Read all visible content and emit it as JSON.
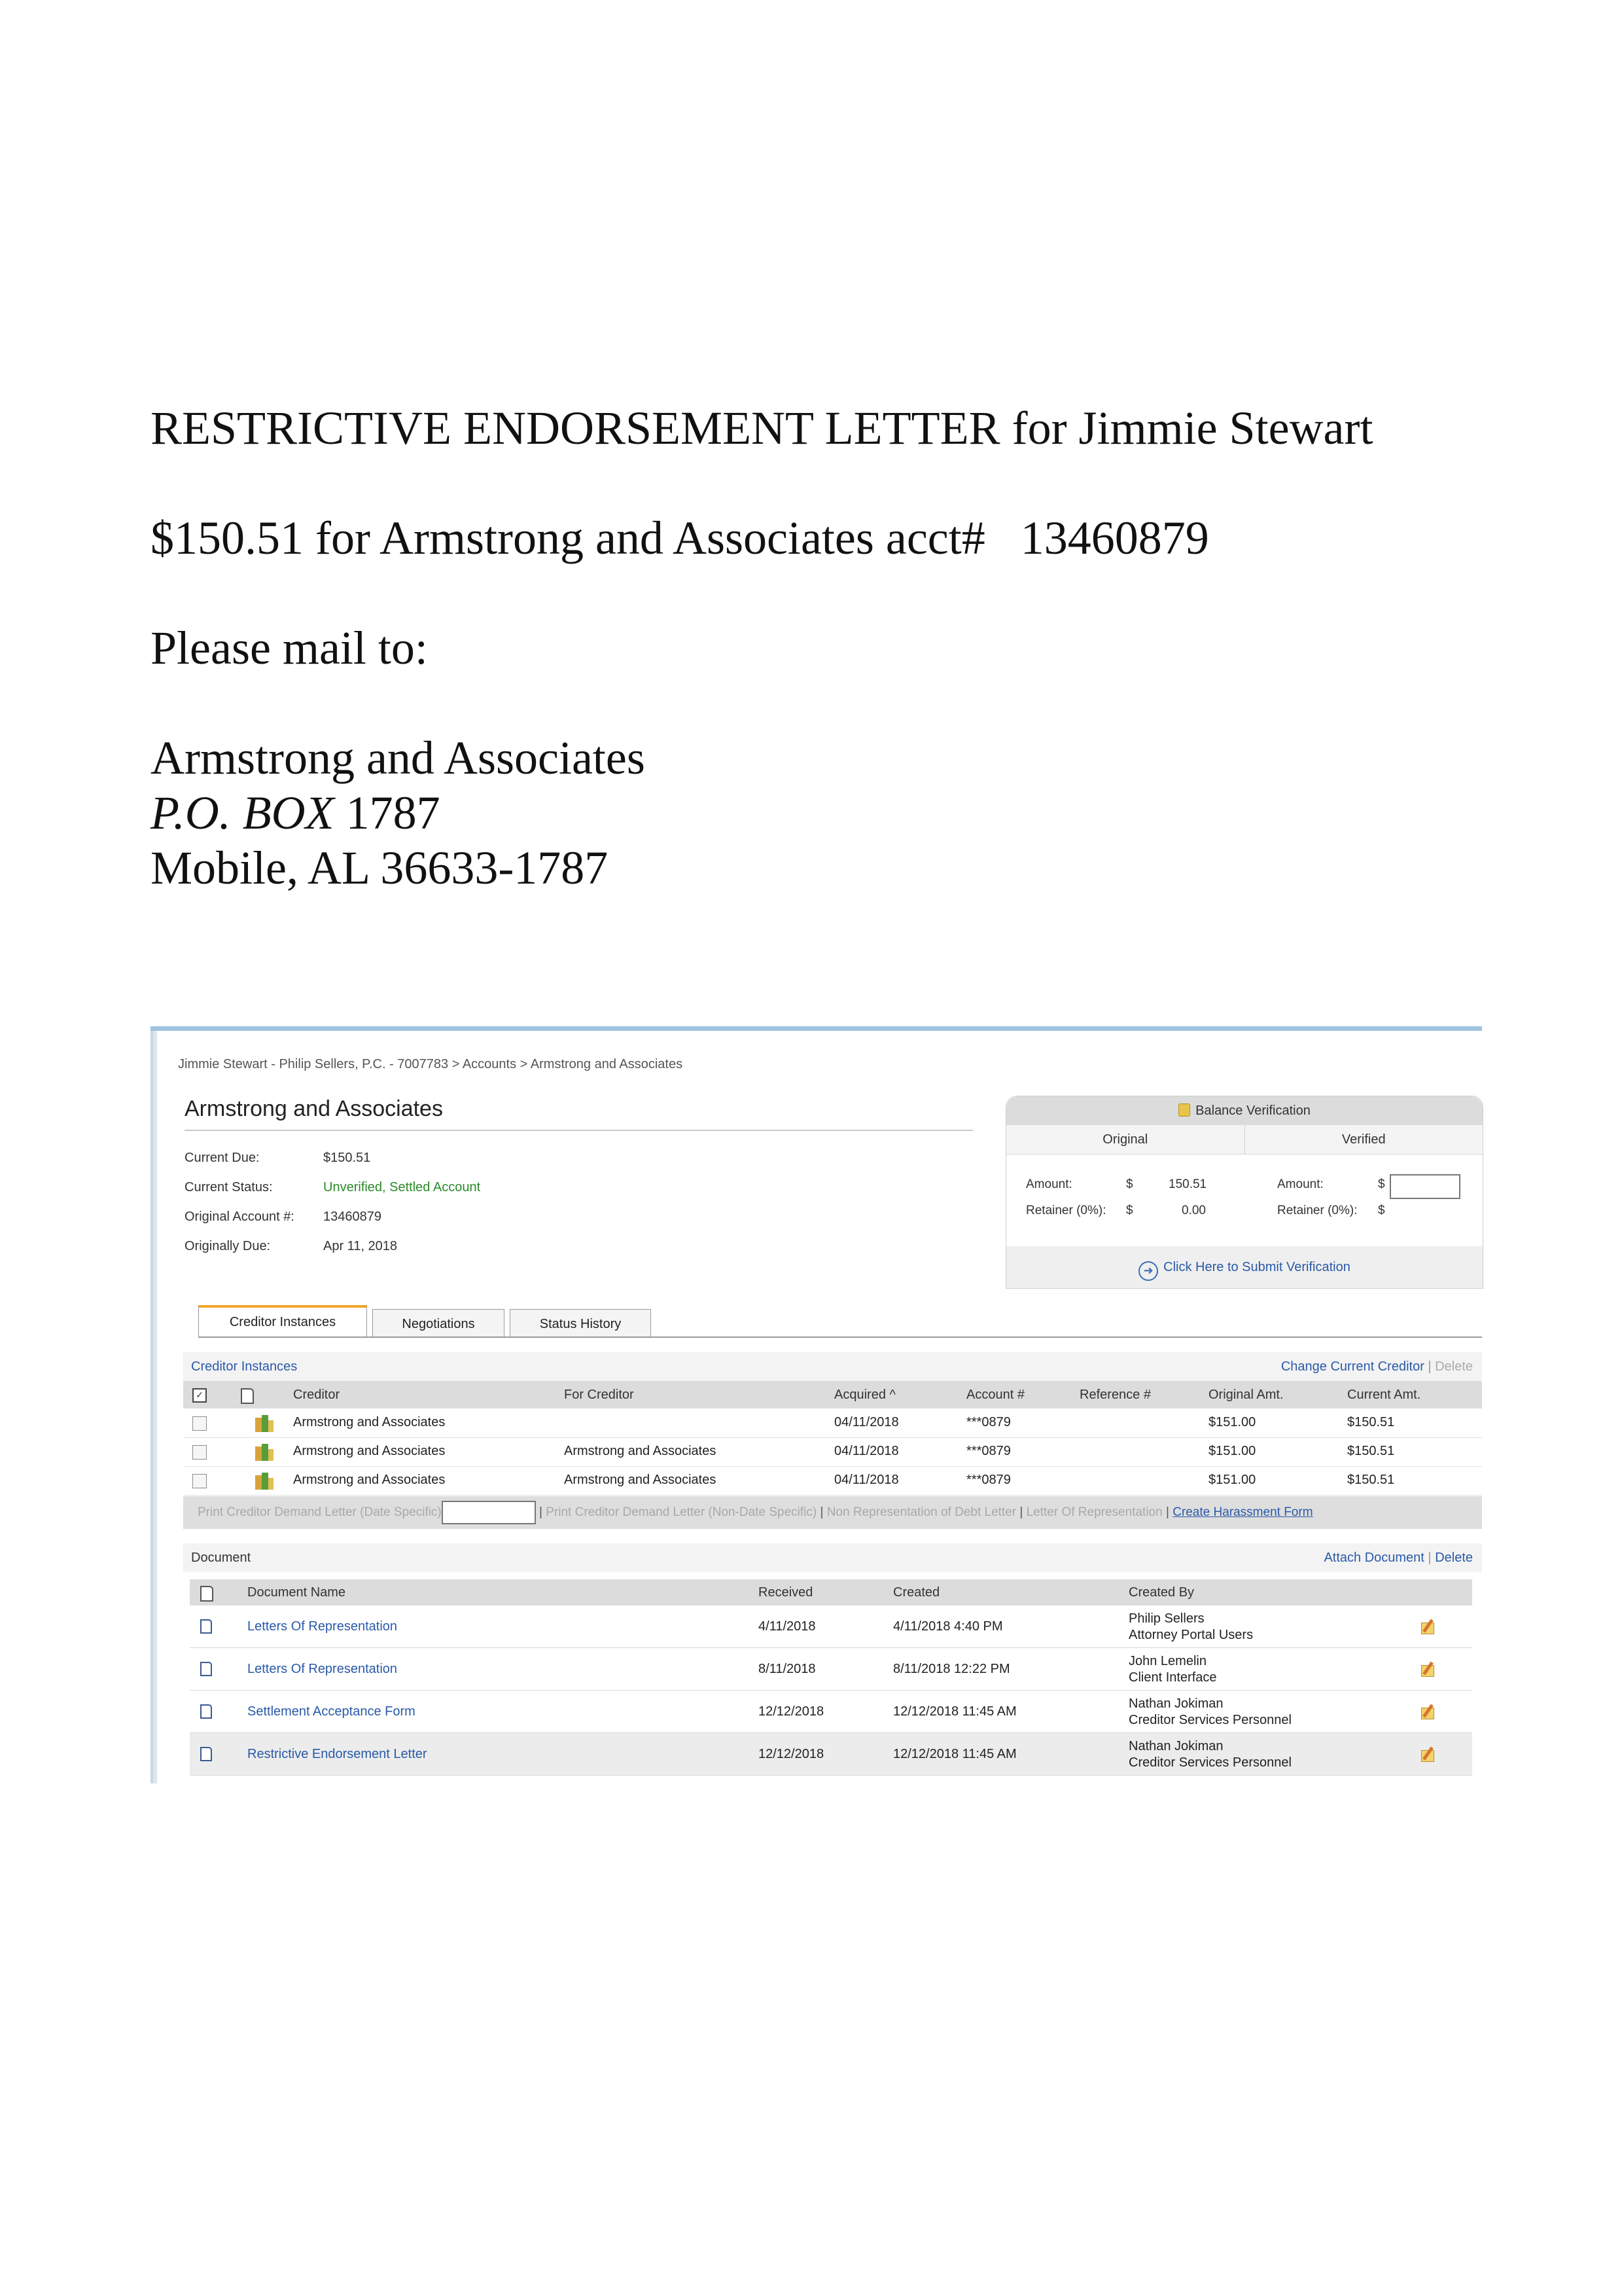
{
  "letter": {
    "title": "RESTRICTIVE ENDORSEMENT LETTER for Jimmie Stewart",
    "amount_line": "$150.51 for Armstrong and Associates acct#   13460879",
    "mail_label": "Please mail to:",
    "address": {
      "name": "Armstrong and Associates",
      "po_prefix": "P.O. BOX",
      "po_number": " 1787",
      "city_line": "Mobile, AL 36633-1787"
    }
  },
  "screenshot": {
    "breadcrumb": "Jimmie Stewart - Philip Sellers, P.C. - 7007783 > Accounts > Armstrong and Associates",
    "account_title": "Armstrong and Associates",
    "info": [
      {
        "label": "Current Due:",
        "value": "$150.51"
      },
      {
        "label": "Current Status:",
        "value": "Unverified, Settled Account"
      },
      {
        "label": "Original Account #:",
        "value": "13460879"
      },
      {
        "label": "Originally Due:",
        "value": "Apr 11, 2018"
      }
    ],
    "balance_verification": {
      "title": "Balance Verification",
      "col_original": "Original",
      "col_verified": "Verified",
      "amount_label": "Amount:",
      "retainer_label": "Retainer (0%):",
      "currency": "$",
      "original_amount": "150.51",
      "original_retainer": "0.00",
      "submit_label": "Click Here to Submit Verification"
    },
    "tabs": [
      "Creditor Instances",
      "Negotiations",
      "Status History"
    ],
    "creditor_section": {
      "title": "Creditor Instances",
      "change_link": "Change Current Creditor",
      "delete_link": "Delete",
      "separator": "|",
      "columns": [
        "Creditor",
        "For Creditor",
        "Acquired ^",
        "Account #",
        "Reference #",
        "Original Amt.",
        "Current Amt."
      ],
      "rows": [
        {
          "creditor": "Armstrong and Associates",
          "for_creditor": "",
          "acquired": "04/11/2018",
          "account": "***0879",
          "reference": "",
          "original": "$151.00",
          "current": "$150.51"
        },
        {
          "creditor": "Armstrong and Associates",
          "for_creditor": "Armstrong and Associates",
          "acquired": "04/11/2018",
          "account": "***0879",
          "reference": "",
          "original": "$151.00",
          "current": "$150.51"
        },
        {
          "creditor": "Armstrong and Associates",
          "for_creditor": "Armstrong and Associates",
          "acquired": "04/11/2018",
          "account": "***0879",
          "reference": "",
          "original": "$151.00",
          "current": "$150.51"
        }
      ],
      "actions": {
        "print_date_specific": "Print Creditor Demand Letter (Date Specific)",
        "print_non_date": "Print Creditor Demand Letter (Non-Date Specific)",
        "non_representation": "Non Representation of Debt Letter",
        "letter_of_representation": "Letter Of Representation",
        "create_harassment": "Create Harassment Form"
      }
    },
    "document_section": {
      "title": "Document",
      "attach_link": "Attach Document",
      "delete_link": "Delete",
      "columns": [
        "Document Name",
        "Received",
        "Created",
        "Created By"
      ],
      "rows": [
        {
          "name": "Letters Of Representation",
          "received": "4/11/2018",
          "created": "4/11/2018 4:40 PM",
          "by_name": "Philip Sellers",
          "by_role": "Attorney Portal Users"
        },
        {
          "name": "Letters Of Representation",
          "received": "8/11/2018",
          "created": "8/11/2018 12:22 PM",
          "by_name": "John Lemelin",
          "by_role": "Client Interface"
        },
        {
          "name": "Settlement Acceptance Form",
          "received": "12/12/2018",
          "created": "12/12/2018 11:45 AM",
          "by_name": "Nathan Jokiman",
          "by_role": "Creditor Services Personnel"
        },
        {
          "name": "Restrictive Endorsement Letter",
          "received": "12/12/2018",
          "created": "12/12/2018 11:45 AM",
          "by_name": "Nathan Jokiman",
          "by_role": "Creditor Services Personnel"
        }
      ]
    },
    "colors": {
      "link": "#2a5aa8",
      "status_green": "#2a8a2a",
      "tab_accent": "#f1a52a",
      "panel_top": "#9ec3e0"
    }
  }
}
